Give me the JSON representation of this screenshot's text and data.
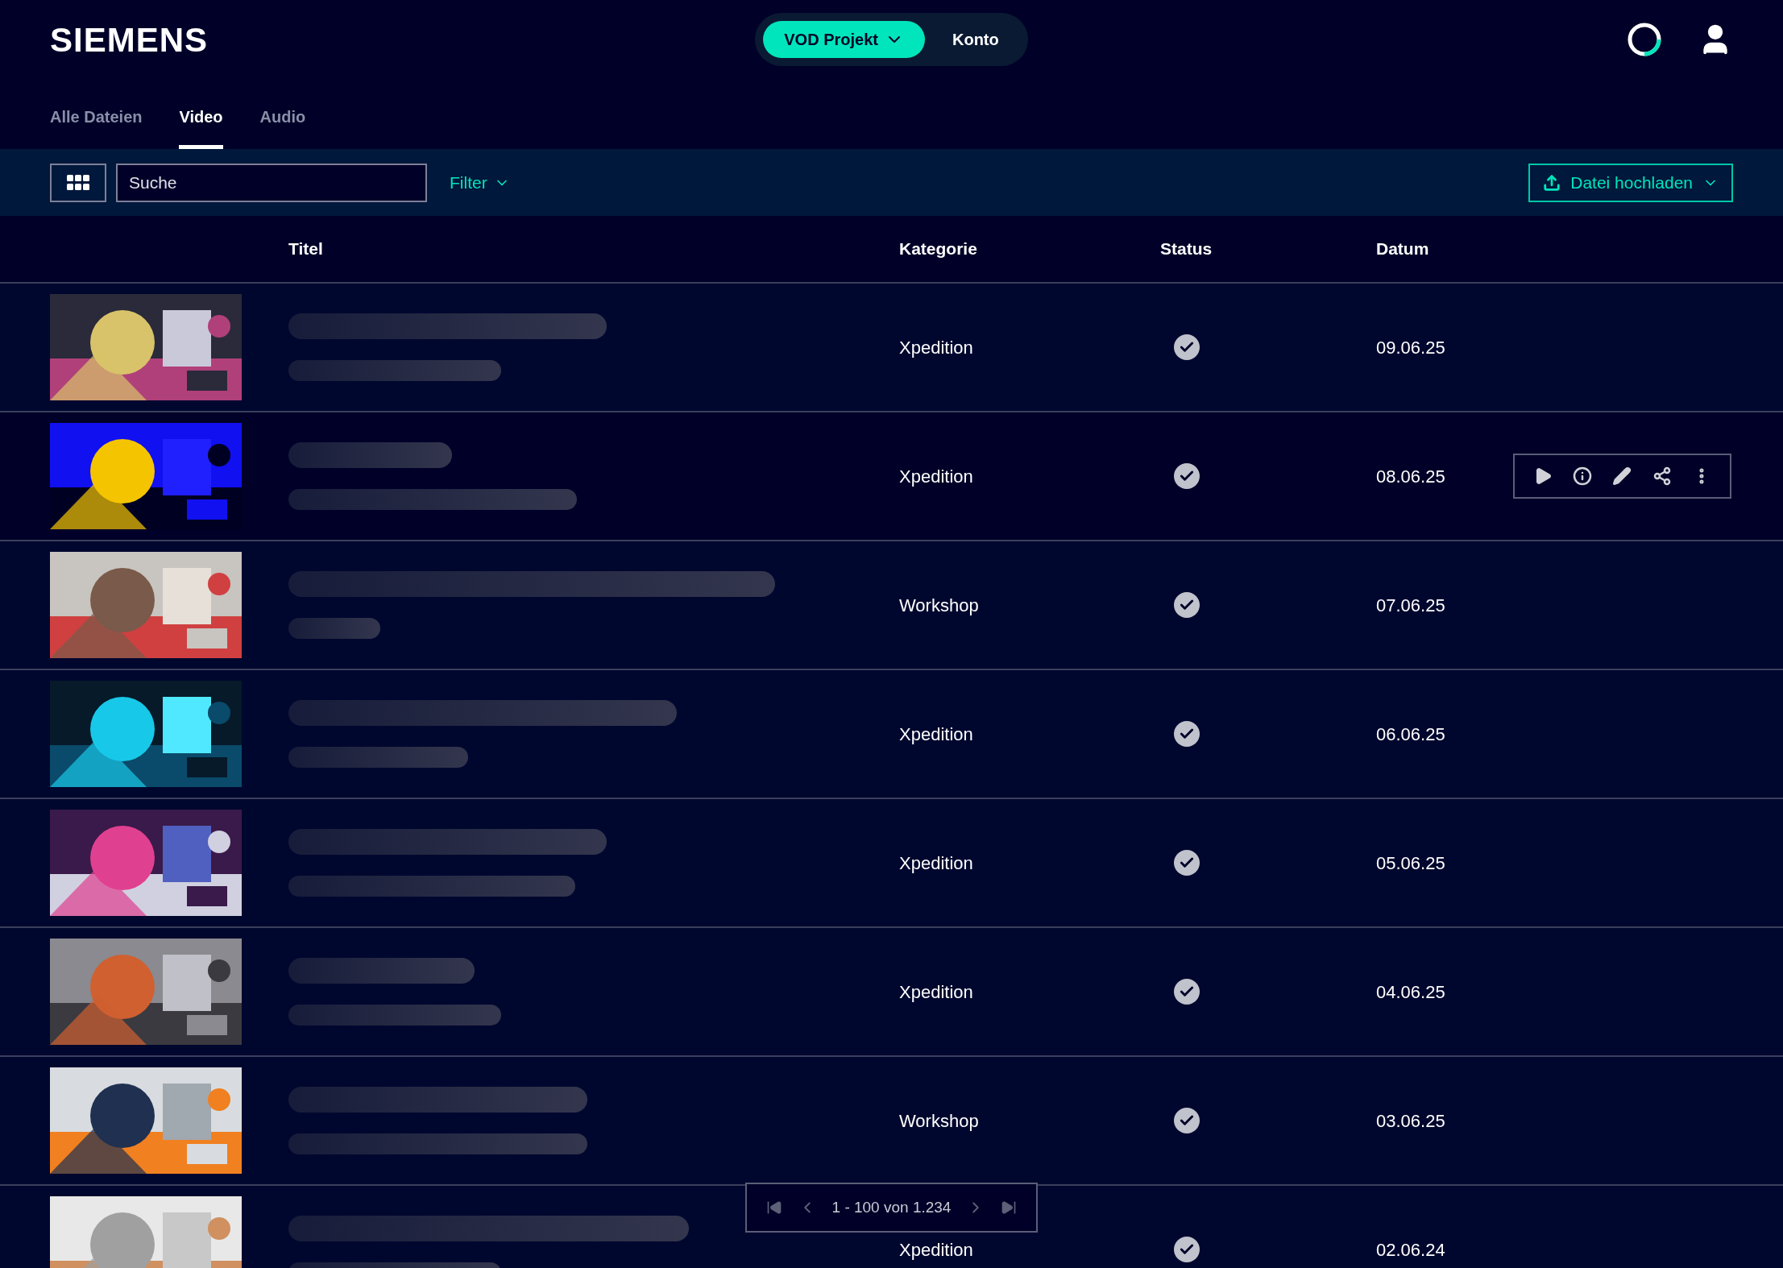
{
  "header": {
    "logo": "SIEMENS",
    "switch": [
      {
        "label": "VOD Projekt",
        "selected": true,
        "dropdown": true
      },
      {
        "label": "Konto",
        "selected": false,
        "dropdown": false
      }
    ]
  },
  "tabs": [
    {
      "label": "Alle Dateien",
      "selected": false
    },
    {
      "label": "Video",
      "selected": true
    },
    {
      "label": "Audio",
      "selected": false
    }
  ],
  "toolbar": {
    "search": {
      "placeholder": "Suche"
    },
    "filter": "Filter",
    "upload": "Datei hochladen"
  },
  "table": {
    "columns": [
      "Titel",
      "Kategorie",
      "Status",
      "Datum"
    ],
    "rows": [
      {
        "category": "Xpedition",
        "date": "09.06.25",
        "hovered": false
      },
      {
        "category": "Xpedition",
        "date": "08.06.25",
        "hovered": true
      },
      {
        "category": "Workshop",
        "date": "07.06.25",
        "hovered": false
      },
      {
        "category": "Xpedition",
        "date": "06.06.25",
        "hovered": false
      },
      {
        "category": "Xpedition",
        "date": "05.06.25",
        "hovered": false
      },
      {
        "category": "Xpedition",
        "date": "04.06.25",
        "hovered": false
      },
      {
        "category": "Workshop",
        "date": "03.06.25",
        "hovered": false
      },
      {
        "category": "Xpedition",
        "date": "02.06.24",
        "hovered": false
      }
    ]
  },
  "pagination": {
    "range": "1 - 100 von 1.234"
  }
}
